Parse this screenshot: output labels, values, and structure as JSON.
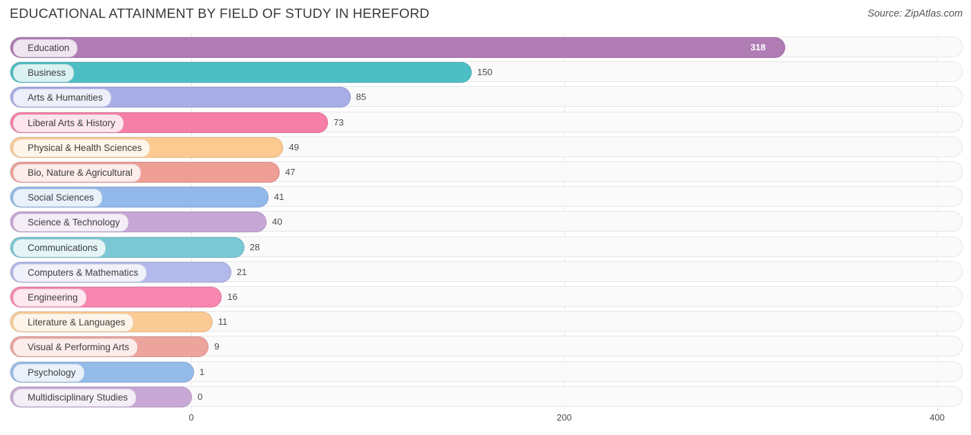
{
  "header": {
    "title": "EDUCATIONAL ATTAINMENT BY FIELD OF STUDY IN HEREFORD",
    "source": "Source: ZipAtlas.com"
  },
  "chart_data": {
    "type": "bar",
    "orientation": "horizontal",
    "title": "EDUCATIONAL ATTAINMENT BY FIELD OF STUDY IN HEREFORD",
    "xlabel": "",
    "ylabel": "",
    "xlim": [
      0,
      400
    ],
    "ticks": [
      0,
      200,
      400
    ],
    "grid": true,
    "legend": "none",
    "categories": [
      "Education",
      "Business",
      "Arts & Humanities",
      "Liberal Arts & History",
      "Physical & Health Sciences",
      "Bio, Nature & Agricultural",
      "Social Sciences",
      "Science & Technology",
      "Communications",
      "Computers & Mathematics",
      "Engineering",
      "Literature & Languages",
      "Visual & Performing Arts",
      "Psychology",
      "Multidisciplinary Studies"
    ],
    "values": [
      318,
      150,
      85,
      73,
      49,
      47,
      41,
      40,
      28,
      21,
      16,
      11,
      9,
      1,
      0
    ],
    "colors": [
      "#b07cb4",
      "#4cbec4",
      "#a7aee6",
      "#f67fa8",
      "#fcca91",
      "#ef9e96",
      "#93b9ea",
      "#c6a6d4",
      "#79c8d4",
      "#b3b9ea",
      "#f786b0",
      "#fbcb95",
      "#eda49c",
      "#95bbe9",
      "#c8a9d6"
    ]
  }
}
